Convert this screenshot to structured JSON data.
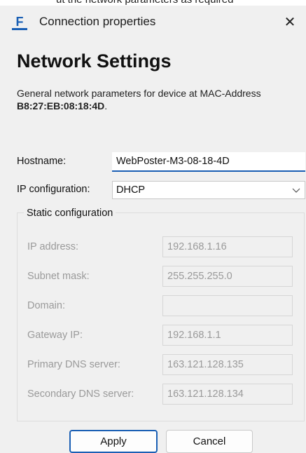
{
  "window": {
    "title": "Connection properties",
    "top_partial_text": "ut the network parameters as required",
    "close_glyph": "✕",
    "icon_letter": "F",
    "accent_color": "#1a5fb4"
  },
  "header": {
    "heading": "Network Settings",
    "description_prefix": "General network parameters for device at MAC-Address ",
    "mac_address": "B8:27:EB:08:18:4D",
    "description_suffix": "."
  },
  "form": {
    "hostname_label": "Hostname:",
    "hostname_value": "WebPoster-M3-08-18-4D",
    "ip_config_label": "IP configuration:",
    "ip_config_value": "DHCP"
  },
  "static_config": {
    "legend": "Static configuration",
    "fields": [
      {
        "label": "IP address:",
        "value": "192.168.1.16"
      },
      {
        "label": "Subnet mask:",
        "value": "255.255.255.0"
      },
      {
        "label": "Domain:",
        "value": ""
      },
      {
        "label": "Gateway IP:",
        "value": "192.168.1.1"
      },
      {
        "label": "Primary DNS server:",
        "value": "163.121.128.135"
      },
      {
        "label": "Secondary DNS server:",
        "value": "163.121.128.134"
      }
    ]
  },
  "buttons": {
    "apply": "Apply",
    "cancel": "Cancel"
  }
}
